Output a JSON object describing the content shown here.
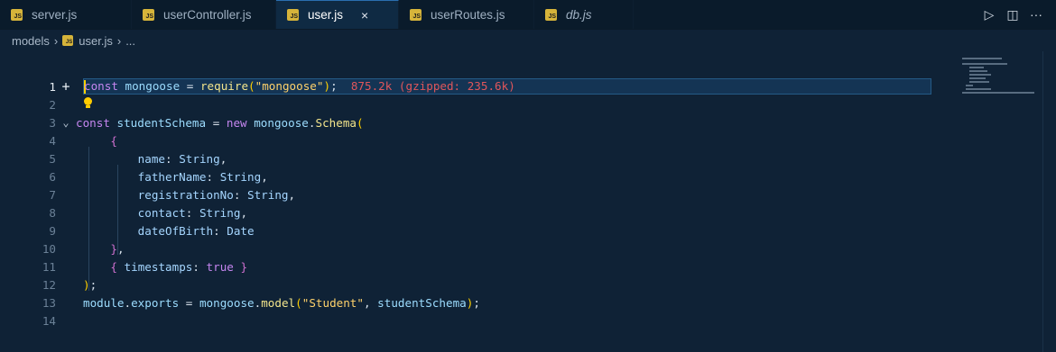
{
  "tabs": [
    {
      "label": "server.js",
      "italic": false,
      "active": false
    },
    {
      "label": "userController.js",
      "italic": false,
      "active": false
    },
    {
      "label": "user.js",
      "italic": false,
      "active": true
    },
    {
      "label": "userRoutes.js",
      "italic": false,
      "active": false
    },
    {
      "label": "db.js",
      "italic": true,
      "active": false
    }
  ],
  "tab_close_glyph": "×",
  "tab_actions": {
    "run": "▷",
    "split": "◫",
    "more": "···"
  },
  "breadcrumb": {
    "folder": "models",
    "file": "user.js",
    "tail": "..."
  },
  "line_numbers": [
    "1",
    "2",
    "3",
    "4",
    "5",
    "6",
    "7",
    "8",
    "9",
    "10",
    "11",
    "12",
    "13",
    "14"
  ],
  "inline_hint": "875.2k (gzipped: 235.6k)",
  "code": {
    "l1_kw": "const",
    "l1_var": "mongoose",
    "l1_fn": "require",
    "l1_str": "\"mongoose\"",
    "l3_kw": "const",
    "l3_var": "studentSchema",
    "l3_new": "new",
    "l3_obj": "mongoose",
    "l3_cls": "Schema",
    "fields": [
      {
        "name": "name",
        "type": "String",
        "comma": ","
      },
      {
        "name": "fatherName",
        "type": "String",
        "comma": ","
      },
      {
        "name": "registrationNo",
        "type": "String",
        "comma": ","
      },
      {
        "name": "contact",
        "type": "String",
        "comma": ","
      },
      {
        "name": "dateOfBirth",
        "type": "Date",
        "comma": ""
      }
    ],
    "l11_prop": "timestamps",
    "l11_bool": "true",
    "l13_obj": "module",
    "l13_prop": "exports",
    "l13_var": "mongoose",
    "l13_fn": "model",
    "l13_str": "\"Student\"",
    "l13_arg": "studentSchema"
  },
  "colors": {
    "accent": "#2a6fb0",
    "js_badge": "#d6b43a",
    "lightbulb": "#ffcc00"
  }
}
